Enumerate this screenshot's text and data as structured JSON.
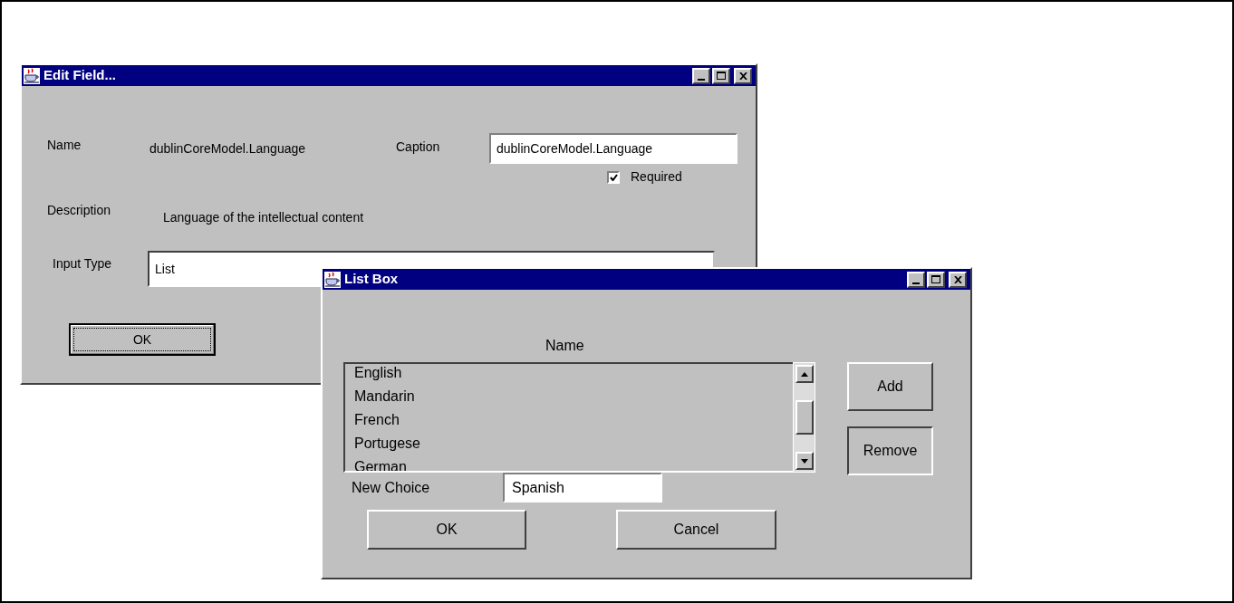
{
  "edit_field": {
    "title": "Edit Field...",
    "name_label": "Name",
    "name_value": "dublinCoreModel.Language",
    "caption_label": "Caption",
    "caption_value": "dublinCoreModel.Language",
    "required": {
      "label": "Required",
      "checked": true
    },
    "description_label": "Description",
    "description_value": "Language of the intellectual content",
    "input_type_label": "Input Type",
    "input_type_value": "List",
    "ok_button": "OK"
  },
  "list_box": {
    "title": "List Box",
    "name_heading": "Name",
    "items": [
      "English",
      "Mandarin",
      "French",
      "Portugese",
      "German"
    ],
    "add_button": "Add",
    "remove_button": "Remove",
    "new_choice_label": "New Choice",
    "new_choice_value": "Spanish",
    "ok_button": "OK",
    "cancel_button": "Cancel"
  }
}
